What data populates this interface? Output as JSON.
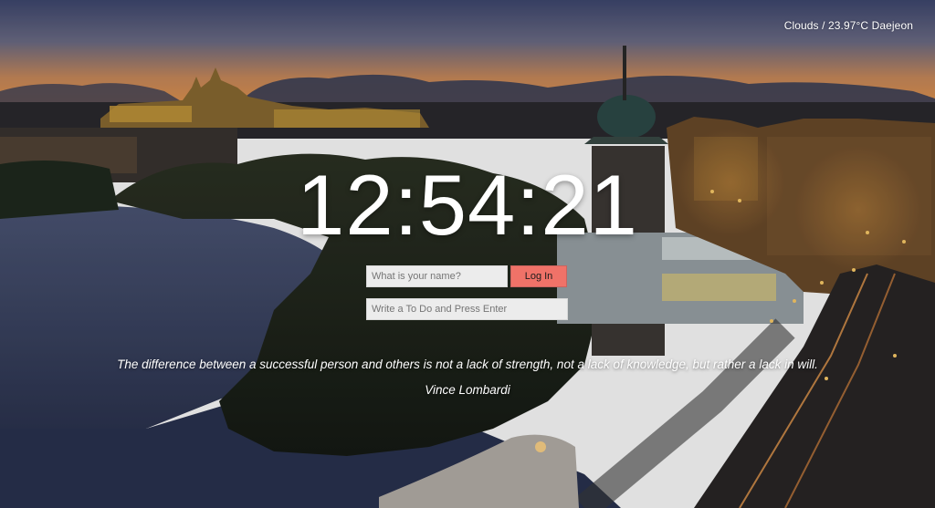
{
  "weather": {
    "text": "Clouds / 23.97°C Daejeon"
  },
  "clock": {
    "time": "12:54:21"
  },
  "login": {
    "name_placeholder": "What is your name?",
    "button_label": "Log In"
  },
  "todo": {
    "placeholder": "Write a To Do and Press Enter"
  },
  "quote": {
    "text": "The difference between a successful person and others is not a lack of strength, not a lack of knowledge, but rather a lack in will.",
    "author": "Vince Lombardi"
  },
  "background": {
    "description_icon": "city-river-dusk-photo",
    "sky_top": "#4a5480",
    "sky_glow": "#e9904a",
    "water": "#3a4566",
    "button_color": "#f07268"
  }
}
